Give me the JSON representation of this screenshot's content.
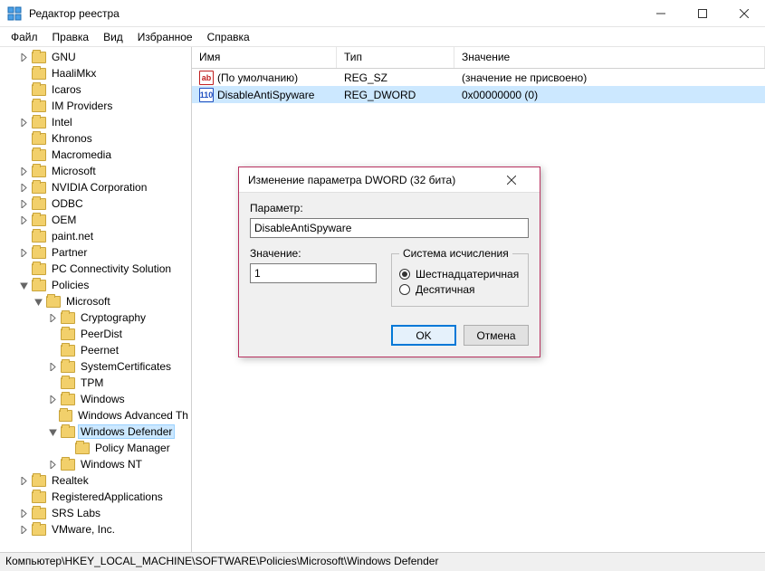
{
  "window": {
    "title": "Редактор реестра"
  },
  "menu": {
    "file": "Файл",
    "edit": "Правка",
    "view": "Вид",
    "favorites": "Избранное",
    "help": "Справка"
  },
  "tree": {
    "items": [
      {
        "d": 1,
        "t": "c",
        "label": "GNU"
      },
      {
        "d": 1,
        "t": "l",
        "label": "HaaliMkx"
      },
      {
        "d": 1,
        "t": "l",
        "label": "Icaros"
      },
      {
        "d": 1,
        "t": "l",
        "label": "IM Providers"
      },
      {
        "d": 1,
        "t": "c",
        "label": "Intel"
      },
      {
        "d": 1,
        "t": "l",
        "label": "Khronos"
      },
      {
        "d": 1,
        "t": "l",
        "label": "Macromedia"
      },
      {
        "d": 1,
        "t": "c",
        "label": "Microsoft"
      },
      {
        "d": 1,
        "t": "c",
        "label": "NVIDIA Corporation"
      },
      {
        "d": 1,
        "t": "c",
        "label": "ODBC"
      },
      {
        "d": 1,
        "t": "c",
        "label": "OEM"
      },
      {
        "d": 1,
        "t": "l",
        "label": "paint.net"
      },
      {
        "d": 1,
        "t": "c",
        "label": "Partner"
      },
      {
        "d": 1,
        "t": "l",
        "label": "PC Connectivity Solution"
      },
      {
        "d": 1,
        "t": "o",
        "label": "Policies"
      },
      {
        "d": 2,
        "t": "o",
        "label": "Microsoft"
      },
      {
        "d": 3,
        "t": "c",
        "label": "Cryptography"
      },
      {
        "d": 3,
        "t": "l",
        "label": "PeerDist"
      },
      {
        "d": 3,
        "t": "l",
        "label": "Peernet"
      },
      {
        "d": 3,
        "t": "c",
        "label": "SystemCertificates"
      },
      {
        "d": 3,
        "t": "l",
        "label": "TPM"
      },
      {
        "d": 3,
        "t": "c",
        "label": "Windows"
      },
      {
        "d": 3,
        "t": "l",
        "label": "Windows Advanced Th"
      },
      {
        "d": 3,
        "t": "o",
        "label": "Windows Defender",
        "selected": true
      },
      {
        "d": 4,
        "t": "l",
        "label": "Policy Manager"
      },
      {
        "d": 3,
        "t": "c",
        "label": "Windows NT"
      },
      {
        "d": 1,
        "t": "c",
        "label": "Realtek"
      },
      {
        "d": 1,
        "t": "l",
        "label": "RegisteredApplications"
      },
      {
        "d": 1,
        "t": "c",
        "label": "SRS Labs"
      },
      {
        "d": 1,
        "t": "c",
        "label": "VMware, Inc."
      }
    ]
  },
  "list": {
    "headers": {
      "name": "Имя",
      "type": "Тип",
      "value": "Значение"
    },
    "rows": [
      {
        "icon": "str",
        "name": "(По умолчанию)",
        "type": "REG_SZ",
        "value": "(значение не присвоено)",
        "selected": false
      },
      {
        "icon": "dword",
        "name": "DisableAntiSpyware",
        "type": "REG_DWORD",
        "value": "0x00000000 (0)",
        "selected": true
      }
    ]
  },
  "dialog": {
    "title": "Изменение параметра DWORD (32 бита)",
    "param_label": "Параметр:",
    "param_value": "DisableAntiSpyware",
    "value_label": "Значение:",
    "value_value": "1",
    "radix_label": "Система исчисления",
    "radix_hex": "Шестнадцатеричная",
    "radix_dec": "Десятичная",
    "ok": "OK",
    "cancel": "Отмена"
  },
  "statusbar": {
    "path": "Компьютер\\HKEY_LOCAL_MACHINE\\SOFTWARE\\Policies\\Microsoft\\Windows Defender"
  }
}
